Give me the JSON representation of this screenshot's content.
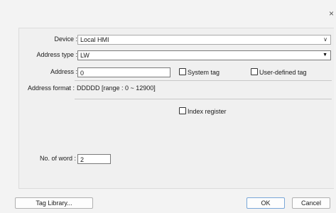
{
  "dialog": {
    "close_glyph": "×"
  },
  "device": {
    "label": "Device :",
    "value": "Local HMI"
  },
  "address_type": {
    "label": "Address type :",
    "value": "LW"
  },
  "address": {
    "label": "Address :",
    "value": "0"
  },
  "system_tag": {
    "label": "System tag",
    "checked": false
  },
  "user_defined_tag": {
    "label": "User-defined tag",
    "checked": false
  },
  "address_format": {
    "label": "Address format :",
    "value": "DDDDD [range : 0 ~ 12900]"
  },
  "index_register": {
    "label": "Index register",
    "checked": false
  },
  "no_of_word": {
    "label": "No. of word :",
    "value": "2"
  },
  "buttons": {
    "tag_library": "Tag Library...",
    "ok": "OK",
    "cancel": "Cancel"
  }
}
